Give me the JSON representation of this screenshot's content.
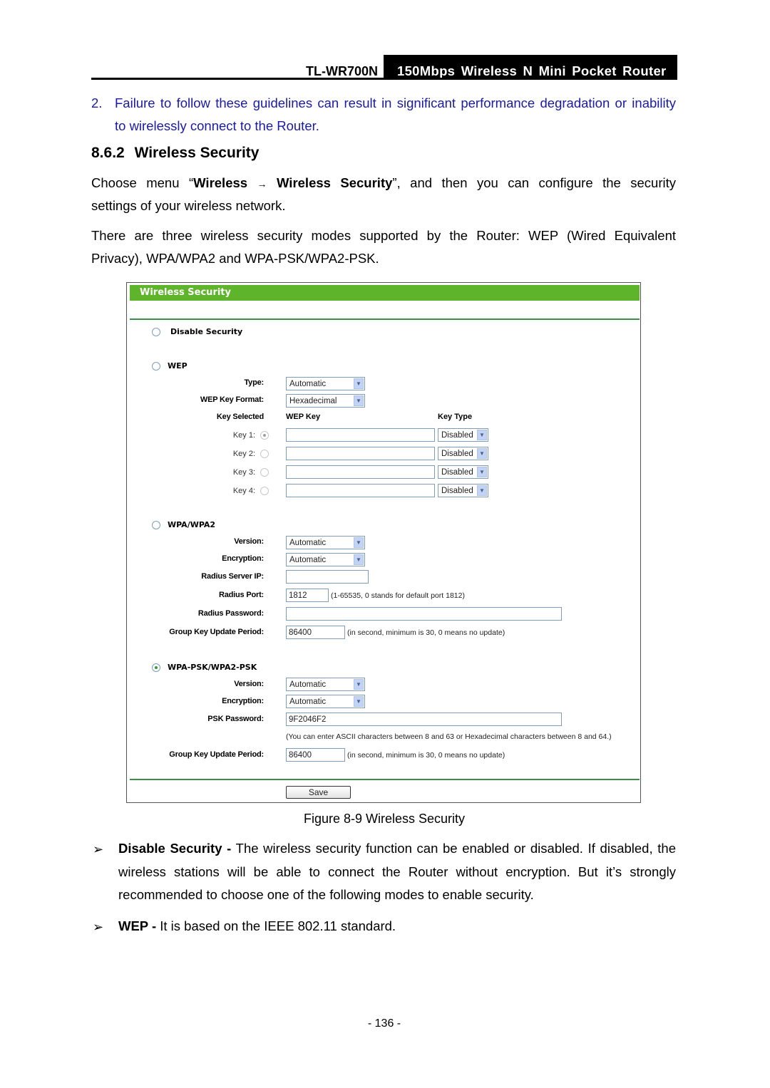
{
  "header": {
    "model": "TL-WR700N",
    "product": "150Mbps Wireless N Mini Pocket Router"
  },
  "note": {
    "number": "2.",
    "line1": "Failure to follow these guidelines can result in significant performance degradation or inability",
    "line2": "to wirelessly connect to the Router."
  },
  "section": {
    "number": "8.6.2",
    "title": "Wireless Security"
  },
  "intro": {
    "p1_prefix": "Choose menu “",
    "p1_menu1": "Wireless",
    "p1_arrow": "→",
    "p1_menu2": "Wireless Security",
    "p1_suffix": "”, and then you can configure the security",
    "p1_line2": "settings of your wireless network.",
    "p2_line1": "There are three wireless security modes supported by the Router: WEP (Wired Equivalent",
    "p2_line2": "Privacy), WPA/WPA2 and WPA-PSK/WPA2-PSK."
  },
  "figure": {
    "title": "Wireless Security",
    "caption": "Figure 8-9 Wireless Security",
    "disable": {
      "label": "Disable Security",
      "selected": false
    },
    "wep": {
      "label": "WEP",
      "selected": false,
      "type_label": "Type:",
      "type_value": "Automatic",
      "format_label": "WEP Key Format:",
      "format_value": "Hexadecimal",
      "col_selected": "Key Selected",
      "col_key": "WEP Key",
      "col_type": "Key Type",
      "keys": [
        {
          "label": "Key 1:",
          "selected": true,
          "value": "",
          "type": "Disabled"
        },
        {
          "label": "Key 2:",
          "selected": false,
          "value": "",
          "type": "Disabled"
        },
        {
          "label": "Key 3:",
          "selected": false,
          "value": "",
          "type": "Disabled"
        },
        {
          "label": "Key 4:",
          "selected": false,
          "value": "",
          "type": "Disabled"
        }
      ]
    },
    "wpa": {
      "label": "WPA/WPA2",
      "selected": false,
      "version_label": "Version:",
      "version_value": "Automatic",
      "encryption_label": "Encryption:",
      "encryption_value": "Automatic",
      "radius_ip_label": "Radius Server IP:",
      "radius_ip_value": "",
      "radius_port_label": "Radius Port:",
      "radius_port_value": "1812",
      "radius_port_hint": "(1-65535, 0 stands for default port 1812)",
      "radius_password_label": "Radius Password:",
      "radius_password_value": "",
      "group_key_label": "Group Key Update Period:",
      "group_key_value": "86400",
      "group_key_hint": "(in second, minimum is 30, 0 means no update)"
    },
    "psk": {
      "label": "WPA-PSK/WPA2-PSK",
      "selected": true,
      "version_label": "Version:",
      "version_value": "Automatic",
      "encryption_label": "Encryption:",
      "encryption_value": "Automatic",
      "password_label": "PSK Password:",
      "password_value": "9F2046F2",
      "password_hint": "(You can enter ASCII characters between 8 and 63 or Hexadecimal characters between 8 and 64.)",
      "group_key_label": "Group Key Update Period:",
      "group_key_value": "86400",
      "group_key_hint": "(in second, minimum is 30, 0 means no update)"
    },
    "save_label": "Save"
  },
  "bullets": [
    {
      "term": "Disable Security -",
      "line1": " The wireless security function can be enabled or disabled. If disabled, the",
      "line2": "wireless stations will be able to connect the Router without encryption. But it’s strongly",
      "line3": "recommended to choose one of the following modes to enable security."
    },
    {
      "term": "WEP -",
      "line1": " It is based on the IEEE 802.11 standard."
    }
  ],
  "bullet_glyph": "➢",
  "page_number": "- 136 -",
  "colors": {
    "title_bar": "#5eb52c",
    "note_text": "#1a1aa6",
    "header_box": "#000000"
  }
}
